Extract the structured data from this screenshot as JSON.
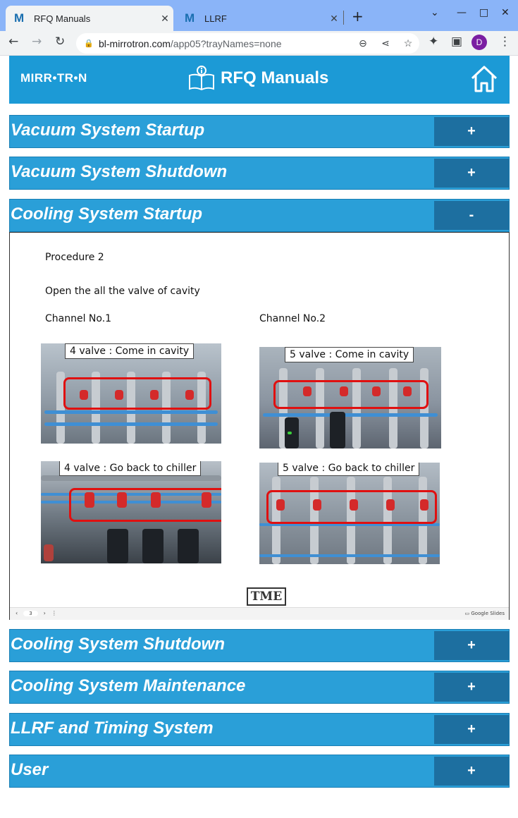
{
  "browser": {
    "tabs": [
      {
        "favicon": "M",
        "title": "RFQ Manuals",
        "close": "✕"
      },
      {
        "favicon": "M",
        "title": "LLRF",
        "close": "✕"
      }
    ],
    "new_tab": "+",
    "url_host": "bl-mirrotron.com",
    "url_path": "/app05?trayNames=none",
    "profile_initial": "D"
  },
  "header": {
    "logo": "MIRR•TR•N",
    "title": "RFQ Manuals",
    "icons": [
      "manual-icon",
      "home-icon"
    ]
  },
  "sections": [
    {
      "label": "Vacuum System Startup",
      "toggle": "+"
    },
    {
      "label": "Vacuum System Shutdown",
      "toggle": "+"
    },
    {
      "label": "Cooling System Startup",
      "toggle": "-"
    },
    {
      "label": "Cooling System Shutdown",
      "toggle": "+"
    },
    {
      "label": "Cooling System Maintenance",
      "toggle": "+"
    },
    {
      "label": "LLRF and Timing System",
      "toggle": "+"
    },
    {
      "label": "User",
      "toggle": "+"
    }
  ],
  "slide": {
    "procedure": "Procedure 2",
    "instruction": "Open the all the valve of cavity",
    "channel1": "Channel No.1",
    "channel2": "Channel No.2",
    "captions": [
      "4 valve : Come in cavity",
      "5 valve : Come in cavity",
      "4 valve : Go back to chiller",
      "5 valve : Go back to chiller"
    ],
    "logo": "TME",
    "page": "3",
    "brand": "Google Slides"
  },
  "colors": {
    "header_bg": "#1c9ad6",
    "accordion_bg": "#2a9fd8",
    "toggle_bg": "#1d6fa0",
    "highlight_ring": "#e01010"
  }
}
